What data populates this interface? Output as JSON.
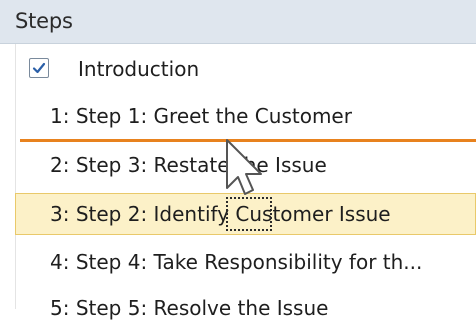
{
  "header": {
    "title": "Steps"
  },
  "intro": {
    "label": "Introduction",
    "checked": true
  },
  "steps": [
    {
      "label": "1:  Step 1: Greet the Customer"
    },
    {
      "label": "2:  Step 3: Restate the Issue"
    },
    {
      "label": "3:  Step 2: Identify Customer Issue"
    },
    {
      "label": "4:  Step 4: Take Responsibility for th..."
    },
    {
      "label": "5:  Step 5: Resolve the Issue"
    }
  ],
  "colors": {
    "drop_indicator": "#e8821e",
    "selected_row": "#fcf1c8",
    "header_bg": "#dfe6ee"
  },
  "icons": {
    "checkbox": "checkmark-icon",
    "pointer": "mouse-cursor-icon"
  }
}
